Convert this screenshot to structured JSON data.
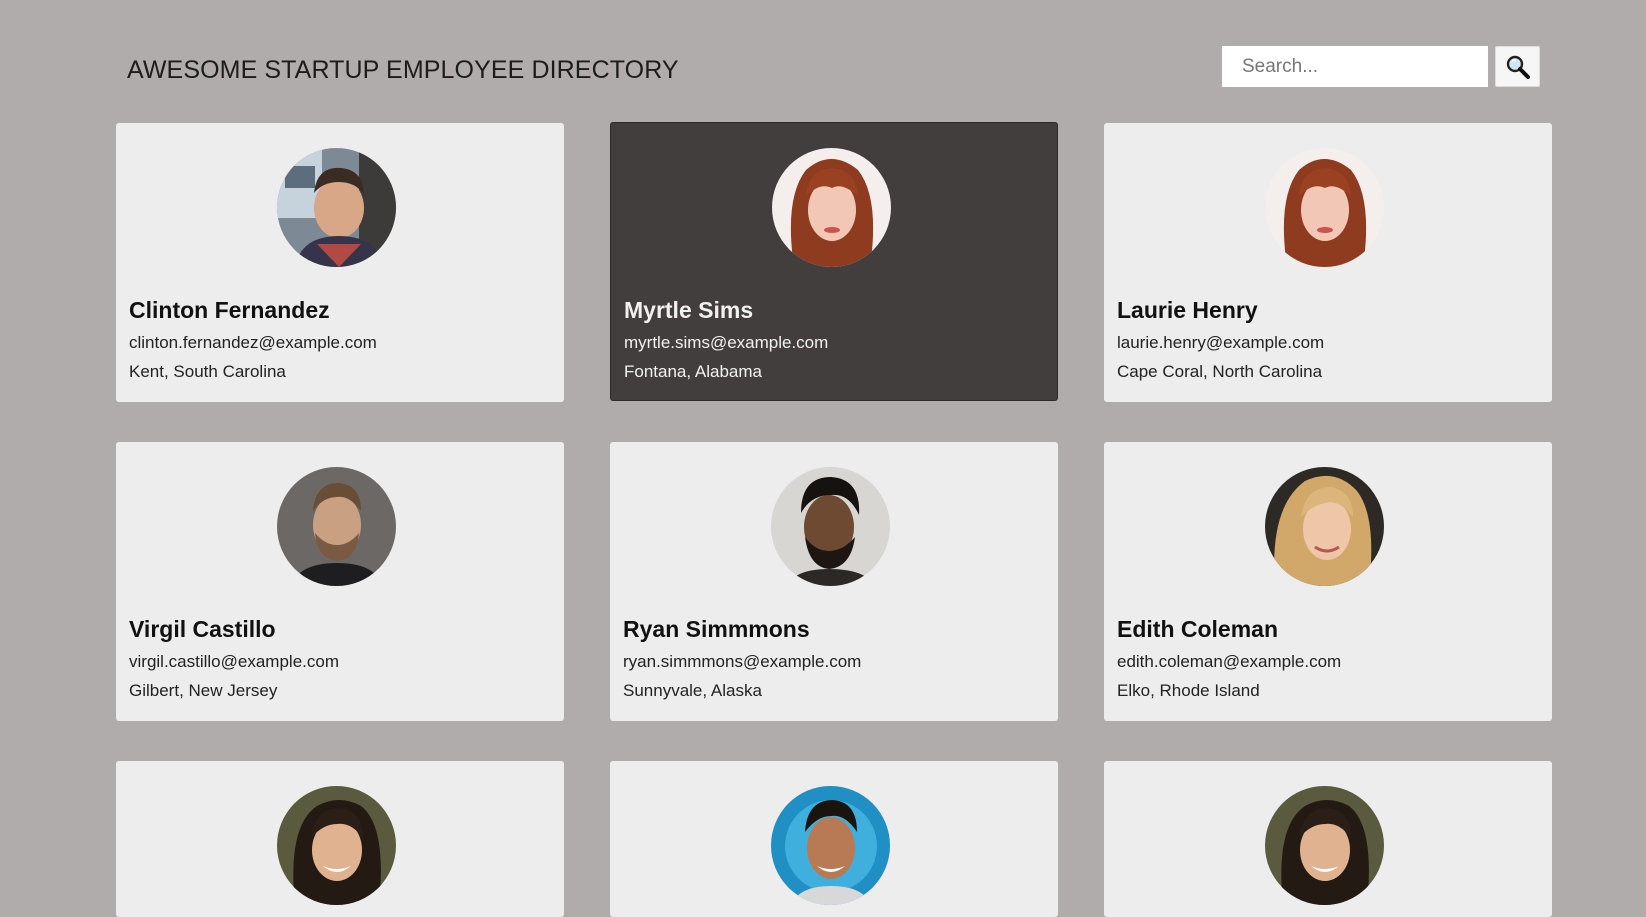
{
  "header": {
    "title": "AWESOME STARTUP EMPLOYEE DIRECTORY",
    "search_placeholder": "Search...",
    "search_icon": "magnifier-icon"
  },
  "colors": {
    "page_background": "#b0acab",
    "card_background": "#ededed",
    "selected_card_background": "#423e3d"
  },
  "employees": [
    {
      "name": "Clinton Fernandez",
      "email": "clinton.fernandez@example.com",
      "location": "Kent, South Carolina",
      "selected": false
    },
    {
      "name": "Myrtle Sims",
      "email": "myrtle.sims@example.com",
      "location": "Fontana, Alabama",
      "selected": true
    },
    {
      "name": "Laurie Henry",
      "email": "laurie.henry@example.com",
      "location": "Cape Coral, North Carolina",
      "selected": false
    },
    {
      "name": "Virgil Castillo",
      "email": "virgil.castillo@example.com",
      "location": "Gilbert, New Jersey",
      "selected": false
    },
    {
      "name": "Ryan Simmmons",
      "email": "ryan.simmmons@example.com",
      "location": "Sunnyvale, Alaska",
      "selected": false
    },
    {
      "name": "Edith Coleman",
      "email": "edith.coleman@example.com",
      "location": "Elko, Rhode Island",
      "selected": false
    },
    {
      "name": "",
      "email": "",
      "location": "",
      "selected": false
    },
    {
      "name": "",
      "email": "",
      "location": "",
      "selected": false
    },
    {
      "name": "",
      "email": "",
      "location": "",
      "selected": false
    }
  ]
}
